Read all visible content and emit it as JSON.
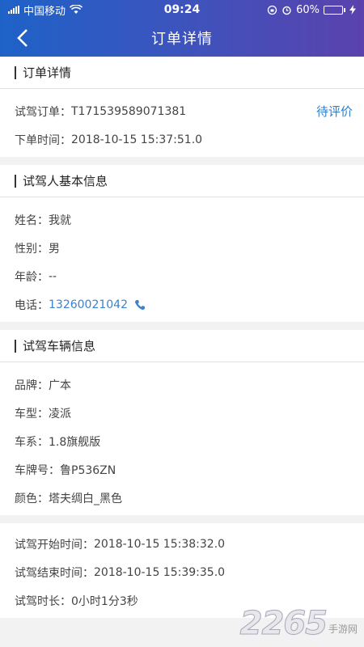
{
  "status_bar": {
    "carrier": "中国移动",
    "time": "09:24",
    "battery": "60%",
    "battery_level": 0.6
  },
  "nav": {
    "title": "订单详情"
  },
  "order": {
    "section_title": "订单详情",
    "order_no_label": "试驾订单：",
    "order_no": "T171539589071381",
    "status": "待评价",
    "time_label": "下单时间：",
    "time": "2018-10-15 15:37:51.0"
  },
  "driver": {
    "section_title": "试驾人基本信息",
    "name_label": "姓名：",
    "name": "我就",
    "gender_label": "性别：",
    "gender": "男",
    "age_label": "年龄：",
    "age": "--",
    "phone_label": "电话：",
    "phone": "13260021042"
  },
  "vehicle": {
    "section_title": "试驾车辆信息",
    "brand_label": "品牌：",
    "brand": "广本",
    "model_label": "车型：",
    "model": "凌派",
    "series_label": "车系：",
    "series": "1.8旗舰版",
    "plate_label": "车牌号：",
    "plate": "鲁P536ZN",
    "color_label": "颜色：",
    "color": "塔夫绸白_黑色"
  },
  "drive": {
    "start_label": "试驾开始时间：",
    "start": "2018-10-15 15:38:32.0",
    "end_label": "试驾结束时间：",
    "end": "2018-10-15 15:39:35.0",
    "duration_label": "试驾时长：",
    "duration": "0小时1分3秒"
  },
  "watermark": {
    "number": "2265",
    "text": "手游网"
  },
  "colors": {
    "header_start": "#1e62c8",
    "header_end": "#5b42ad",
    "link": "#2f7fd0"
  }
}
